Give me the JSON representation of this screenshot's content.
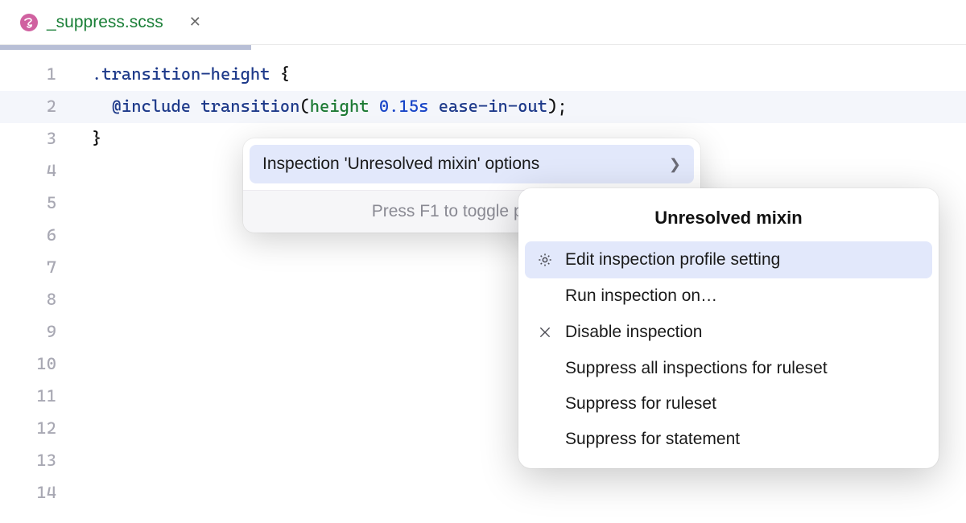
{
  "tab": {
    "filename": "_suppress.scss",
    "close_glyph": "✕"
  },
  "gutter": {
    "lines": [
      "1",
      "2",
      "3",
      "4",
      "5",
      "6",
      "7",
      "8",
      "9",
      "10",
      "11",
      "12",
      "13",
      "14"
    ]
  },
  "code": {
    "line1_selector": ".transition-height",
    "line1_space": " ",
    "line1_brace_open": "{",
    "line2_indent": "  ",
    "line2_at": "@include",
    "line2_space1": " ",
    "line2_mixin": "transition",
    "line2_paren_open": "(",
    "line2_prop": "height",
    "line2_space2": " ",
    "line2_num": "0.15s",
    "line2_space3": " ",
    "line2_ease": "ease-in-out",
    "line2_paren_close": ")",
    "line2_semicolon": ";",
    "line3_brace_close": "}"
  },
  "popup_primary": {
    "item_label": "Inspection 'Unresolved mixin' options",
    "footer": "Press F1 to toggle preview"
  },
  "popup_submenu": {
    "title": "Unresolved mixin",
    "items": {
      "edit": "Edit inspection profile setting",
      "run": "Run inspection on…",
      "disable": "Disable inspection",
      "suppress_all": "Suppress all inspections for ruleset",
      "suppress_ruleset": "Suppress for ruleset",
      "suppress_statement": "Suppress for statement"
    }
  }
}
